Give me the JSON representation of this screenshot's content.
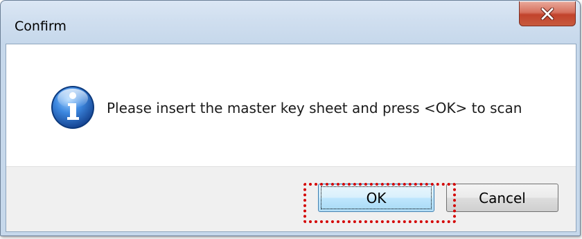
{
  "window": {
    "title": "Confirm",
    "close_icon": "close-icon"
  },
  "message": {
    "icon": "info-icon",
    "text": "Please insert the master key sheet and press <OK> to scan"
  },
  "buttons": {
    "ok_label": "OK",
    "cancel_label": "Cancel"
  },
  "colors": {
    "close_button": "#c7432c",
    "highlight": "#d40000",
    "ok_button_border": "#3c7fb1",
    "info_icon": "#1f5fb0"
  }
}
